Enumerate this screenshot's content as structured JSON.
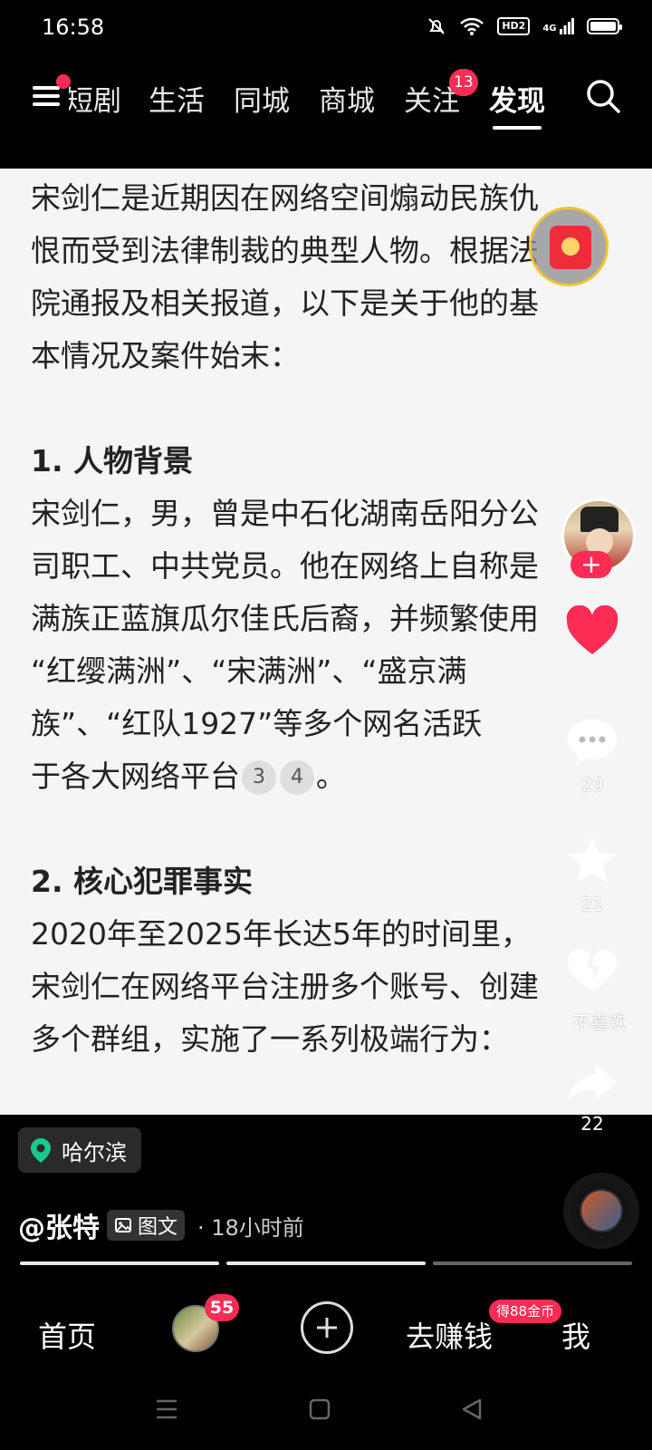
{
  "status_bar": {
    "time": "16:58",
    "hd_label": "HD2",
    "signal_label": "4G"
  },
  "top_nav": {
    "tabs": [
      {
        "label": "短剧"
      },
      {
        "label": "生活"
      },
      {
        "label": "同城"
      },
      {
        "label": "商城"
      },
      {
        "label": "关注",
        "badge": "13"
      },
      {
        "label": "发现"
      }
    ],
    "active_tab": "发现"
  },
  "article": {
    "lines": [
      "宋剑仁是近期因在网络空间煽动民族仇",
      "恨而受到法律制裁的典型人物。根据法",
      "院通报及相关报道，以下是关于他的基",
      "本情况及案件始末："
    ],
    "section1_title": "1. 人物背景",
    "section1_lines": [
      "宋剑仁，男，曾是中石化湖南岳阳分公",
      "司职工、中共党员。他在网络上自称是",
      "满族正蓝旗瓜尔佳氏后裔，并频繁使用",
      "“红缨满洲”、“宋满洲”、“盛京满",
      "族”、“红队1927”等多个网名活跃"
    ],
    "section1_last": "于各大网络平台",
    "refs": [
      "3",
      "4"
    ],
    "section1_end": "。",
    "section2_title": "2. 核心犯罪事实",
    "section2_lines": [
      "2020年至2025年长达5年的时间里，",
      "宋剑仁在网络平台注册多个账号、创建",
      "多个群组，实施了一系列极端行为："
    ]
  },
  "side_actions": {
    "comment_count": "29",
    "favorite_count": "21",
    "dislike_label": "不喜欢",
    "share_count": "22"
  },
  "bottom_info": {
    "location": "哈尔滨",
    "author": "@张特",
    "post_type": "图文",
    "time_ago": "· 18小时前"
  },
  "bottom_nav": {
    "home": "首页",
    "friends_badge": "55",
    "earn": "去赚钱",
    "earn_badge": "得88金币",
    "me": "我"
  },
  "colors": {
    "accent": "#fe2c55",
    "content_bg": "#f5f5f5",
    "text": "#222222"
  }
}
